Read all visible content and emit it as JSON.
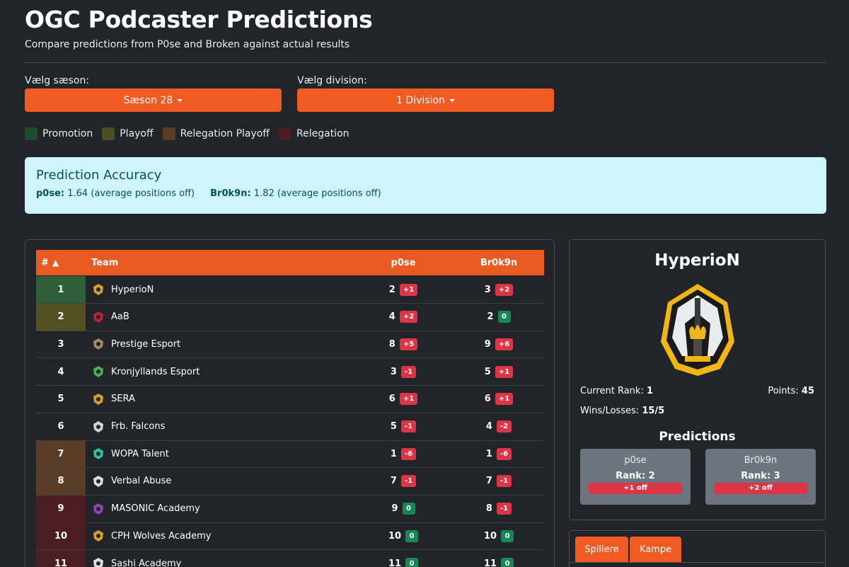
{
  "header": {
    "title": "OGC Podcaster Predictions",
    "subtitle": "Compare predictions from P0se and Broken against actual results"
  },
  "selectors": {
    "season_label": "Vælg sæson:",
    "season_value": "Sæson 28",
    "division_label": "Vælg division:",
    "division_value": "1 Division"
  },
  "legend": [
    {
      "label": "Promotion",
      "color": "#1f4d2c"
    },
    {
      "label": "Playoff",
      "color": "#4d4d22"
    },
    {
      "label": "Relegation Playoff",
      "color": "#5c3d24"
    },
    {
      "label": "Relegation",
      "color": "#4a1c1f"
    }
  ],
  "accuracy": {
    "title": "Prediction Accuracy",
    "p0se_name": "p0se:",
    "p0se_value": "1.64 (average positions off)",
    "broken_name": "Br0k9n:",
    "broken_value": "1.82 (average positions off)"
  },
  "table": {
    "headers": {
      "rank": "#",
      "sort_icon": "▲",
      "team": "Team",
      "p0se": "p0se",
      "broken": "Br0k9n"
    },
    "rows": [
      {
        "rank": "1",
        "team": "HyperioN",
        "zone": "#2d5e37",
        "p": "2",
        "pd": "+1",
        "pc": "red",
        "b": "3",
        "bd": "+2",
        "bc": "red",
        "icon": "hyperion-logo-icon",
        "ic": "#d4a12a"
      },
      {
        "rank": "2",
        "team": "AaB",
        "zone": "#535024",
        "p": "4",
        "pd": "+2",
        "pc": "red",
        "b": "2",
        "bd": "0",
        "bc": "green",
        "icon": "aab-logo-icon",
        "ic": "#c0203a"
      },
      {
        "rank": "3",
        "team": "Prestige Esport",
        "zone": "",
        "p": "8",
        "pd": "+5",
        "pc": "red",
        "b": "9",
        "bd": "+6",
        "bc": "red",
        "icon": "prestige-logo-icon",
        "ic": "#a58a5e"
      },
      {
        "rank": "4",
        "team": "Kronjyllands Esport",
        "zone": "",
        "p": "3",
        "pd": "-1",
        "pc": "red",
        "b": "5",
        "bd": "+1",
        "bc": "red",
        "icon": "kronjyllands-logo-icon",
        "ic": "#4caf50"
      },
      {
        "rank": "5",
        "team": "SERA",
        "zone": "",
        "p": "6",
        "pd": "+1",
        "pc": "red",
        "b": "6",
        "bd": "+1",
        "bc": "red",
        "icon": "sera-logo-icon",
        "ic": "#d4a12a"
      },
      {
        "rank": "6",
        "team": "Frb. Falcons",
        "zone": "",
        "p": "5",
        "pd": "-1",
        "pc": "red",
        "b": "4",
        "bd": "-2",
        "bc": "red",
        "icon": "falcons-logo-icon",
        "ic": "#cfd3d6"
      },
      {
        "rank": "7",
        "team": "WOPA Talent",
        "zone": "#5b3d27",
        "p": "1",
        "pd": "-6",
        "pc": "red",
        "b": "1",
        "bd": "-6",
        "bc": "red",
        "icon": "wopa-logo-icon",
        "ic": "#2ec4a0"
      },
      {
        "rank": "8",
        "team": "Verbal Abuse",
        "zone": "#5b3d27",
        "p": "7",
        "pd": "-1",
        "pc": "red",
        "b": "7",
        "bd": "-1",
        "bc": "red",
        "icon": "verbal-abuse-logo-icon",
        "ic": "#dddddd"
      },
      {
        "rank": "9",
        "team": "MASONIC Academy",
        "zone": "#4a1e22",
        "p": "9",
        "pd": "0",
        "pc": "green",
        "b": "8",
        "bd": "-1",
        "bc": "red",
        "icon": "masonic-logo-icon",
        "ic": "#8e44ad"
      },
      {
        "rank": "10",
        "team": "CPH Wolves Academy",
        "zone": "#4a1e22",
        "p": "10",
        "pd": "0",
        "pc": "green",
        "b": "10",
        "bd": "0",
        "bc": "green",
        "icon": "cph-wolves-logo-icon",
        "ic": "#d4a12a"
      },
      {
        "rank": "11",
        "team": "Sashi Academy",
        "zone": "#4a1e22",
        "p": "11",
        "pd": "0",
        "pc": "green",
        "b": "11",
        "bd": "0",
        "bc": "green",
        "icon": "sashi-logo-icon",
        "ic": "#e0e0e0"
      }
    ]
  },
  "detail": {
    "team_name": "HyperioN",
    "rank_label": "Current Rank:",
    "rank_value": "1",
    "points_label": "Points:",
    "points_value": "45",
    "wl_label": "Wins/Losses:",
    "wl_value": "15/5",
    "predictions_title": "Predictions",
    "p0se": {
      "name": "p0se",
      "rank": "Rank: 2",
      "off": "+1 off"
    },
    "broken": {
      "name": "Br0k9n",
      "rank": "Rank: 3",
      "off": "+2 off"
    }
  },
  "tabs": [
    {
      "label": "Spillere"
    },
    {
      "label": "Kampe"
    }
  ]
}
